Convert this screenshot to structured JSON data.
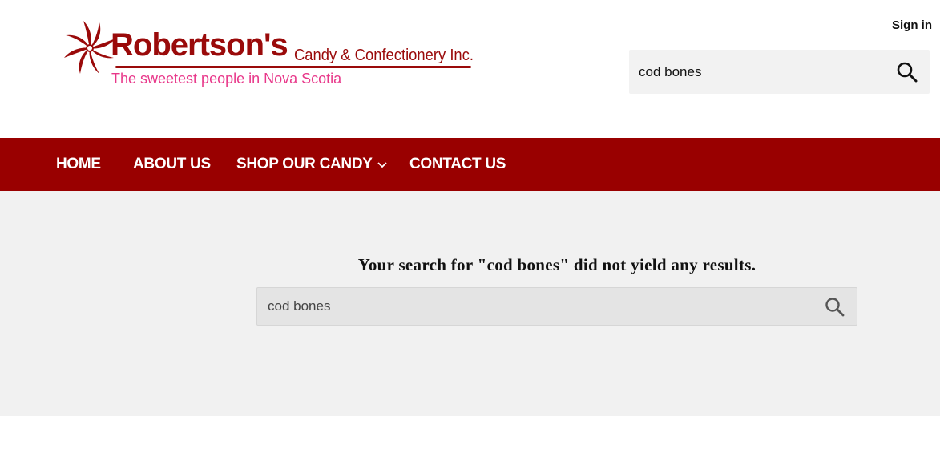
{
  "header": {
    "logo": {
      "title": "Robertson's",
      "subtitle": "Candy & Confectionery Inc.",
      "tagline": "The sweetest people in Nova Scotia"
    },
    "signin_label": "Sign in",
    "search": {
      "value": "cod bones",
      "icon": "search-icon"
    }
  },
  "nav": {
    "items": [
      {
        "label": "HOME"
      },
      {
        "label": "ABOUT US"
      },
      {
        "label": "SHOP OUR CANDY",
        "icon": "chevron-down-icon"
      },
      {
        "label": "CONTACT US"
      }
    ]
  },
  "main": {
    "result_message": "Your search for \"cod bones\" did not yield any results.",
    "search": {
      "value": "cod bones",
      "icon": "search-icon"
    }
  },
  "colors": {
    "brand_red": "#990000",
    "logo_red": "#9a0a0a",
    "tagline_pink": "#e8388a",
    "main_bg": "#f1f1f1",
    "search_bg": "#f2f2f2"
  }
}
